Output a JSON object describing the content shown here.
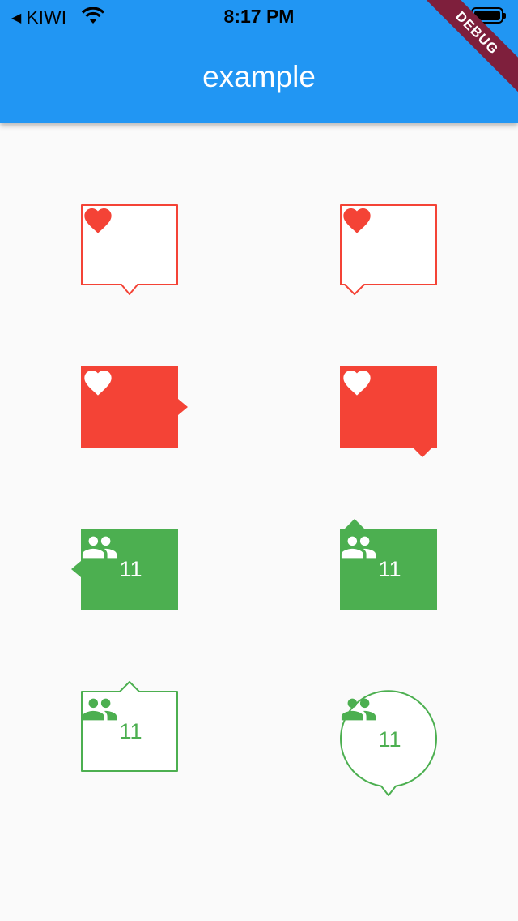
{
  "status_bar": {
    "carrier": "KIWI",
    "time": "8:17 PM",
    "back_glyph": "◀"
  },
  "app_bar": {
    "title": "example"
  },
  "debug_banner": "DEBUG",
  "colors": {
    "app_bar": "#2196f3",
    "red": "#f44336",
    "green": "#4caf50",
    "background": "#fafafa",
    "debug": "#7e1f3c"
  },
  "badges": [
    {
      "icon": "heart-icon",
      "style": "outlined",
      "color": "red",
      "pointer": "bottom-center"
    },
    {
      "icon": "heart-icon",
      "style": "outlined",
      "color": "red",
      "pointer": "bottom-left"
    },
    {
      "icon": "heart-icon",
      "style": "filled",
      "color": "red",
      "pointer": "right-center"
    },
    {
      "icon": "heart-icon",
      "style": "filled",
      "color": "red",
      "pointer": "bottom-right"
    },
    {
      "icon": "people-icon",
      "style": "filled",
      "color": "green",
      "pointer": "left-center",
      "count": "11"
    },
    {
      "icon": "people-icon",
      "style": "filled",
      "color": "green",
      "pointer": "top-left",
      "count": "11"
    },
    {
      "icon": "people-icon",
      "style": "outlined",
      "color": "green",
      "pointer": "top-center",
      "count": "11"
    },
    {
      "icon": "people-icon",
      "style": "outlined-circle",
      "color": "green",
      "pointer": "bottom-center",
      "count": "11"
    }
  ]
}
